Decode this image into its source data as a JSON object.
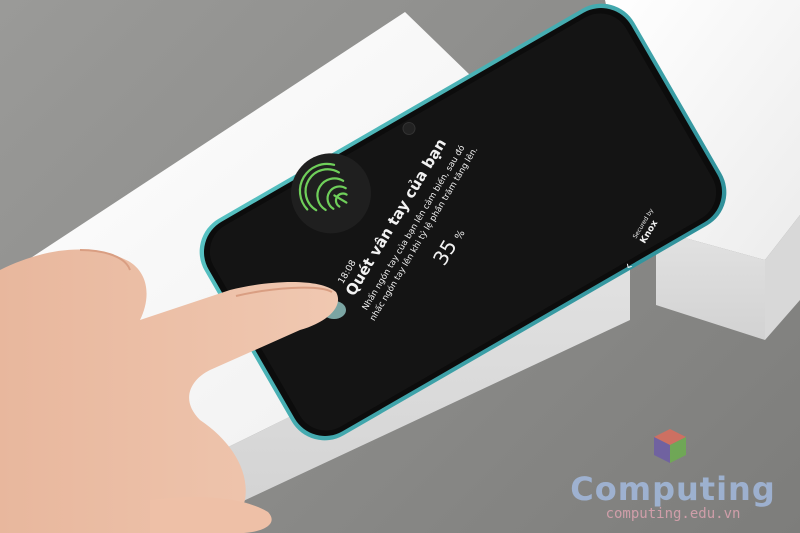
{
  "phone": {
    "status_time": "18:08",
    "title": "Quét vân tay của bạn",
    "instruction_line1": "Nhấn ngón tay của bạn lên cảm biến, sau đó",
    "instruction_line2": "nhấc ngón tay lên khi tỷ lệ phần trăm tăng lên.",
    "progress_value": "35",
    "progress_unit": "%",
    "back_glyph": "‹",
    "footer_secured_by": "Secured by",
    "footer_brand": "Knox"
  },
  "watermark": {
    "word": "Computing",
    "url": "computing.edu.vn"
  },
  "colors": {
    "fingerprint_accent": "#6fcf5a",
    "phone_frame": "#3ea9ad",
    "screen": "#141414",
    "box": "#f6f6f6"
  },
  "icons": [
    "fingerprint-icon",
    "back-arrow-icon",
    "front-camera-icon",
    "logo-icon"
  ]
}
